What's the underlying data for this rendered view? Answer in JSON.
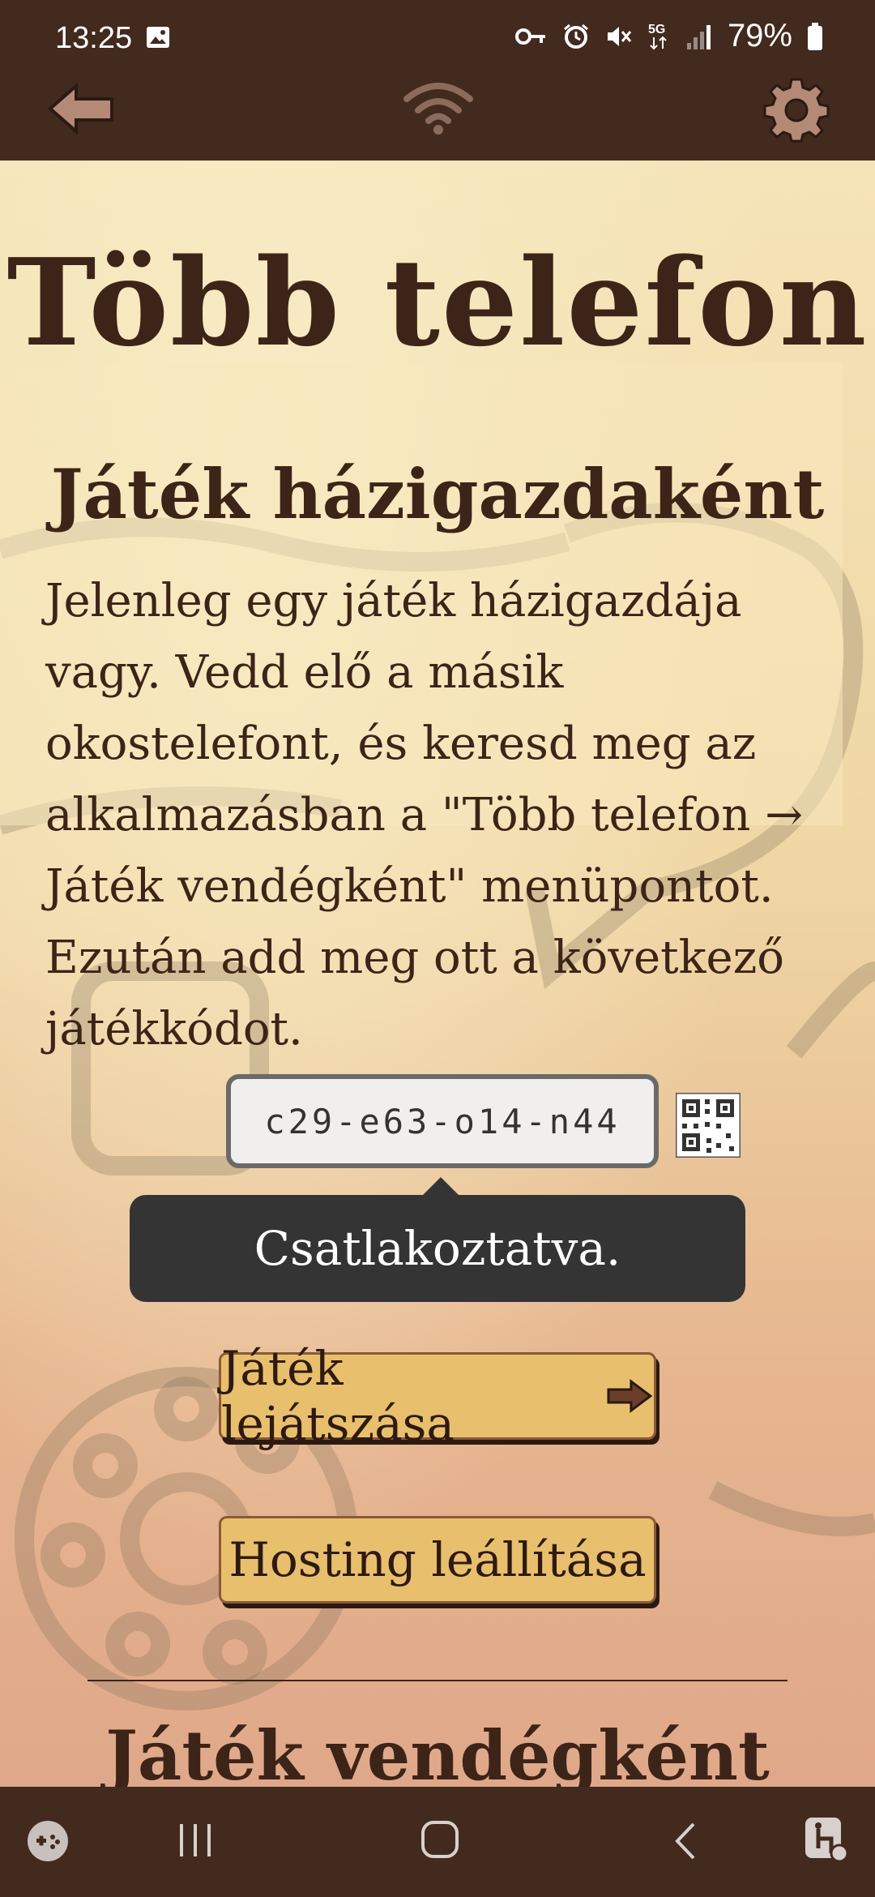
{
  "status_bar": {
    "time": "13:25",
    "battery_percent": "79%",
    "icons": [
      "image-icon",
      "key-icon",
      "alarm-icon",
      "mute-icon",
      "5g-icon",
      "signal-icon",
      "battery-icon"
    ]
  },
  "app_bar": {
    "icons": [
      "back-arrow-icon",
      "wifi-icon",
      "gear-icon"
    ]
  },
  "page": {
    "title": "Több telefon",
    "subtitle": "Játék házigazdaként",
    "paragraph": "Jelenleg egy játék házigazdája vagy. Vedd elő a másik okostelefont, és keresd meg az alkalmazásban a \"Több telefon → Játék vendégként\" menüpontot. Ezután add meg ott a következő játékkódot.",
    "game_code": "c29-e63-o14-n44",
    "toast": "Csatlakoztatva.",
    "play_button": "Játék lejátszása",
    "stop_hosting_button": "Hosting leállítása",
    "section2_title": "Játék vendégként"
  },
  "nav_bar": {
    "icons": [
      "game-launcher-icon",
      "recent-apps-icon",
      "home-icon",
      "back-icon",
      "accessibility-icon"
    ]
  },
  "colors": {
    "bar_bg": "#422a1f",
    "text_brown": "#3d2418",
    "button_fill": "#e8c06d",
    "toast_bg": "#343434"
  }
}
